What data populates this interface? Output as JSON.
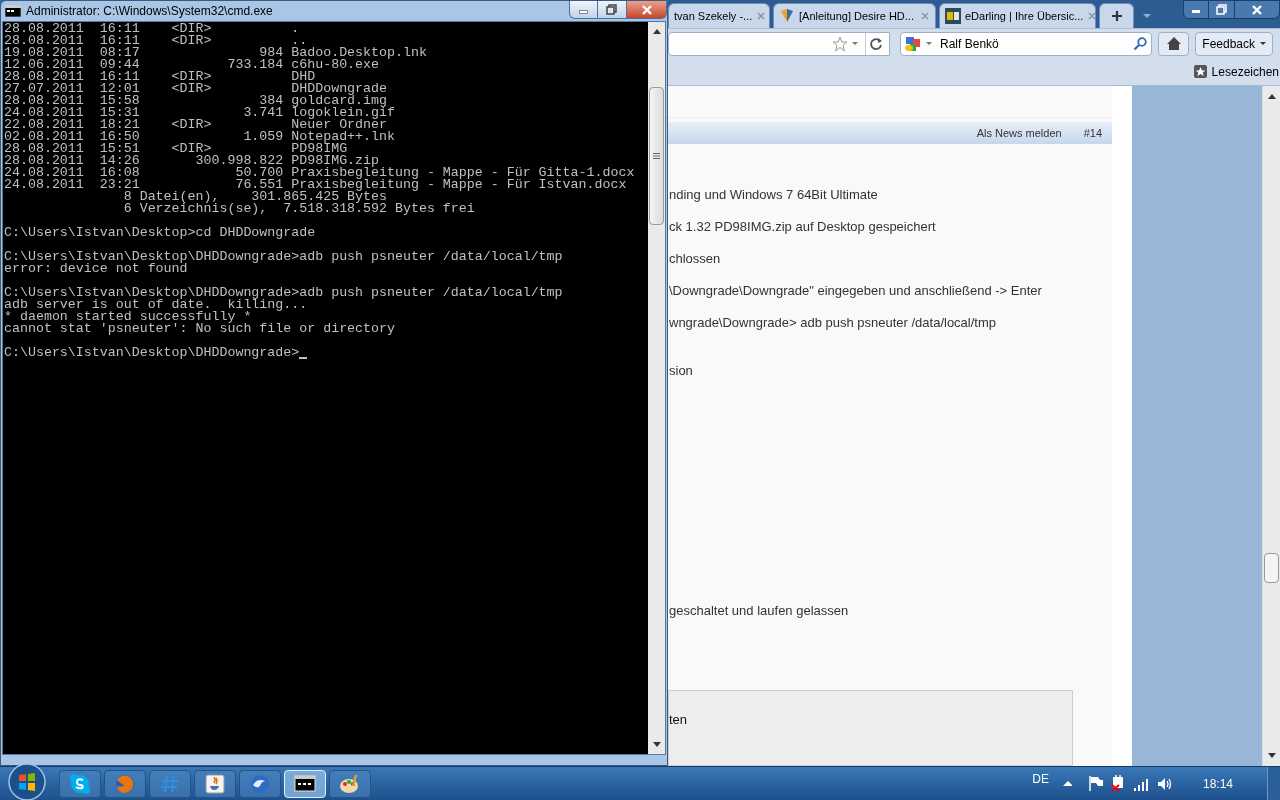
{
  "browser": {
    "tabs": [
      {
        "title": "tvan Szekely -...",
        "kind": "plain",
        "selected": false
      },
      {
        "title": "[Anleitung] Desire HD...",
        "kind": "forum",
        "selected": false
      },
      {
        "title": "eDarling | Ihre Übersic...",
        "kind": "site",
        "selected": false
      }
    ],
    "search": {
      "value": "Ralf Benkö"
    },
    "feedback_button": "Feedback",
    "bookmarks_button": "Lesezeichen",
    "post_header": {
      "report": "Als News melden",
      "number": "#14"
    },
    "post_lines": [
      "nding und Windows 7 64Bit Ultimate",
      "ck 1.32 PD98IMG.zip auf Desktop gespeichert",
      "chlossen",
      "\\Downgrade\\Downgrade\" eingegeben und anschließend -> Enter",
      "wngrade\\Downgrade> adb push psneuter /data/local/tmp",
      "sion",
      "geschaltet und laufen gelassen"
    ],
    "box_text": "ten"
  },
  "console": {
    "title": "Administrator: C:\\Windows\\System32\\cmd.exe",
    "blocks": [
      [
        "28.08.2011  16:11    <DIR>          .",
        "28.08.2011  16:11    <DIR>          ..",
        "19.08.2011  08:17               984 Badoo.Desktop.lnk",
        "12.06.2011  09:44           733.184 c6hu-80.exe",
        "28.08.2011  16:11    <DIR>          DHD",
        "27.07.2011  12:01    <DIR>          DHDDowngrade",
        "28.08.2011  15:58               384 goldcard.img",
        "24.08.2011  15:31             3.741 logoklein.gif",
        "22.08.2011  18:21    <DIR>          Neuer Ordner",
        "02.08.2011  16:50             1.059 Notepad++.lnk",
        "28.08.2011  15:51    <DIR>          PD98IMG",
        "28.08.2011  14:26       300.998.822 PD98IMG.zip",
        "24.08.2011  16:08            50.700 Praxisbegleitung - Mappe - Für Gitta-1.docx",
        "24.08.2011  23:21            76.551 Praxisbegleitung - Mappe - Für Istvan.docx",
        "               8 Datei(en),    301.865.425 Bytes",
        "               6 Verzeichnis(se),  7.518.318.592 Bytes frei"
      ],
      [
        "C:\\Users\\Istvan\\Desktop>cd DHDDowngrade"
      ],
      [
        "C:\\Users\\Istvan\\Desktop\\DHDDowngrade>adb push psneuter /data/local/tmp",
        "error: device not found"
      ],
      [
        "C:\\Users\\Istvan\\Desktop\\DHDDowngrade>adb push psneuter /data/local/tmp",
        "adb server is out of date.  killing...",
        "* daemon started successfully *",
        "cannot stat 'psneuter': No such file or directory"
      ],
      [
        "C:\\Users\\Istvan\\Desktop\\DHDDowngrade>"
      ]
    ],
    "cursor": true
  },
  "taskbar": {
    "apps": [
      {
        "kind": "chat",
        "selected": false
      },
      {
        "kind": "browser",
        "selected": false
      },
      {
        "kind": "hash",
        "selected": false
      },
      {
        "kind": "java",
        "selected": false
      },
      {
        "kind": "mail",
        "selected": false
      },
      {
        "kind": "console",
        "selected": true
      },
      {
        "kind": "paint",
        "selected": false
      }
    ],
    "language": "DE",
    "clock": "18:14"
  }
}
